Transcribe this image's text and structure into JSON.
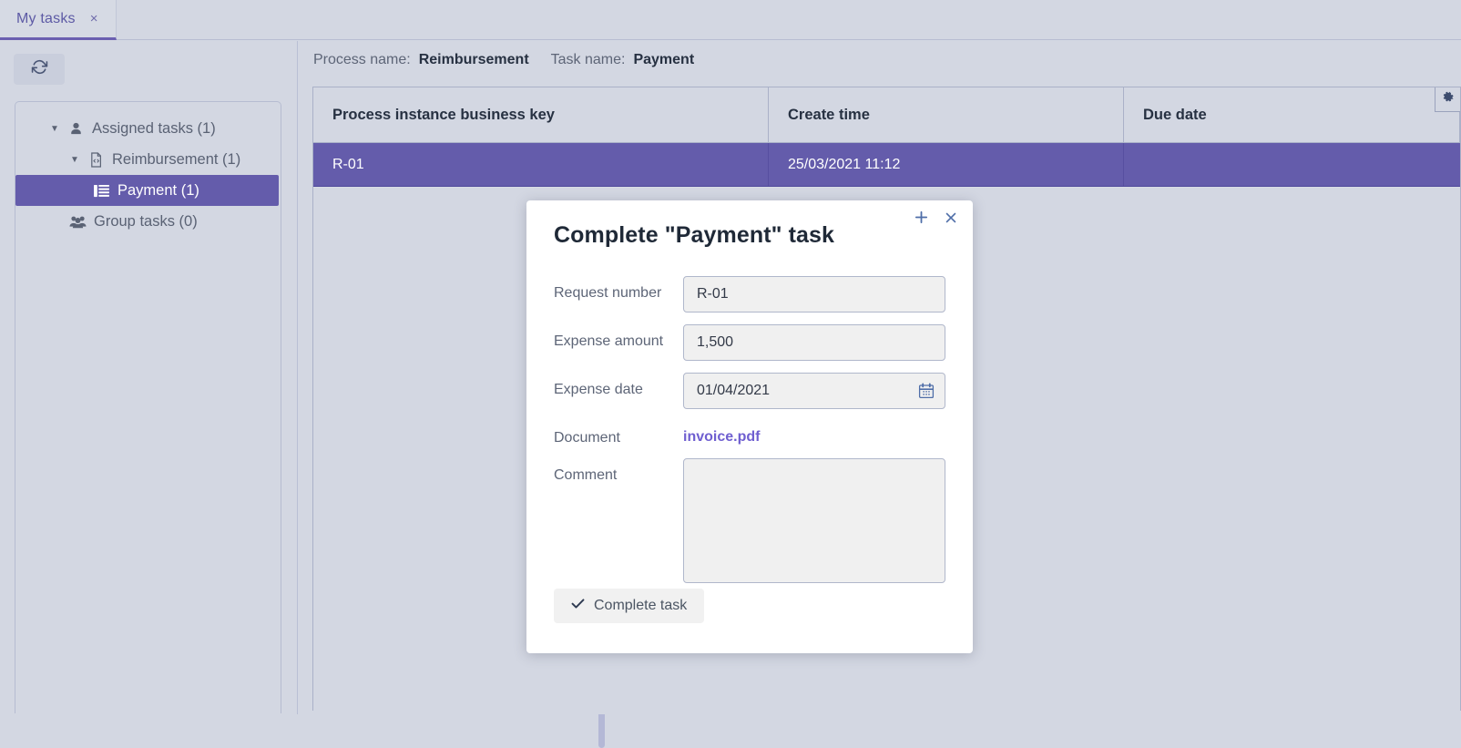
{
  "tab": {
    "label": "My tasks",
    "close_icon": "close-icon",
    "close_glyph": "×"
  },
  "sidebar": {
    "refresh_icon": "refresh-icon",
    "tree": [
      {
        "label": "Assigned tasks (1)",
        "icon": "user-icon",
        "level": 0,
        "expanded": true,
        "selected": false
      },
      {
        "label": "Reimbursement (1)",
        "icon": "file-code-icon",
        "level": 1,
        "expanded": true,
        "selected": false
      },
      {
        "label": "Payment (1)",
        "icon": "list-icon",
        "level": 2,
        "expanded": false,
        "selected": true
      },
      {
        "label": "Group tasks (0)",
        "icon": "users-icon",
        "level": 0,
        "expanded": false,
        "selected": false
      }
    ]
  },
  "breadcrumb": {
    "process_label": "Process name:",
    "process_value": "Reimbursement",
    "task_label": "Task name:",
    "task_value": "Payment"
  },
  "table": {
    "settings_icon": "gear-icon",
    "columns": [
      "Process instance business key",
      "Create time",
      "Due date"
    ],
    "rows": [
      {
        "business_key": "R-01",
        "create_time": "25/03/2021 11:12",
        "due_date": "",
        "selected": true
      }
    ]
  },
  "modal": {
    "title": "Complete \"Payment\" task",
    "expand_icon": "plus-icon",
    "expand_glyph": "+",
    "close_icon": "close-icon",
    "close_glyph": "×",
    "fields": {
      "request_number": {
        "label": "Request number",
        "value": "R-01",
        "placeholder": ""
      },
      "expense_amount": {
        "label": "Expense amount",
        "value": "1,500",
        "placeholder": ""
      },
      "expense_date": {
        "label": "Expense date",
        "value": "01/04/2021",
        "placeholder": "",
        "icon": "calendar-icon"
      },
      "document": {
        "label": "Document",
        "value": "invoice.pdf"
      },
      "comment": {
        "label": "Comment",
        "value": "",
        "placeholder": ""
      }
    },
    "submit_label": "Complete task",
    "submit_icon": "check-icon"
  },
  "colors": {
    "accent_purple": "#645cab",
    "tab_underline": "#6b5fb0",
    "page_background": "#d3d7e2",
    "link_purple": "#6f5fd0",
    "header_text": "#273142"
  }
}
